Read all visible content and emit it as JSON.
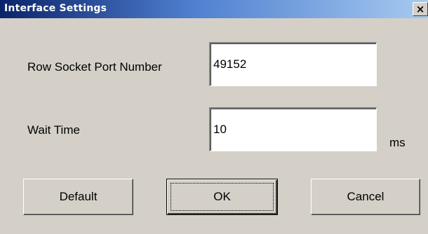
{
  "window": {
    "title": "Interface Settings",
    "close_glyph": "×",
    "close_icon": "close-icon"
  },
  "form": {
    "port": {
      "label": "Row Socket Port Number",
      "value": "49152"
    },
    "wait": {
      "label": "Wait Time",
      "value": "10",
      "unit": "ms"
    }
  },
  "buttons": {
    "default_label": "Default",
    "ok_label": "OK",
    "cancel_label": "Cancel"
  },
  "colors": {
    "dialog_bg": "#d4d0c8",
    "titlebar_start": "#0a246a",
    "titlebar_end": "#a6caf0"
  }
}
